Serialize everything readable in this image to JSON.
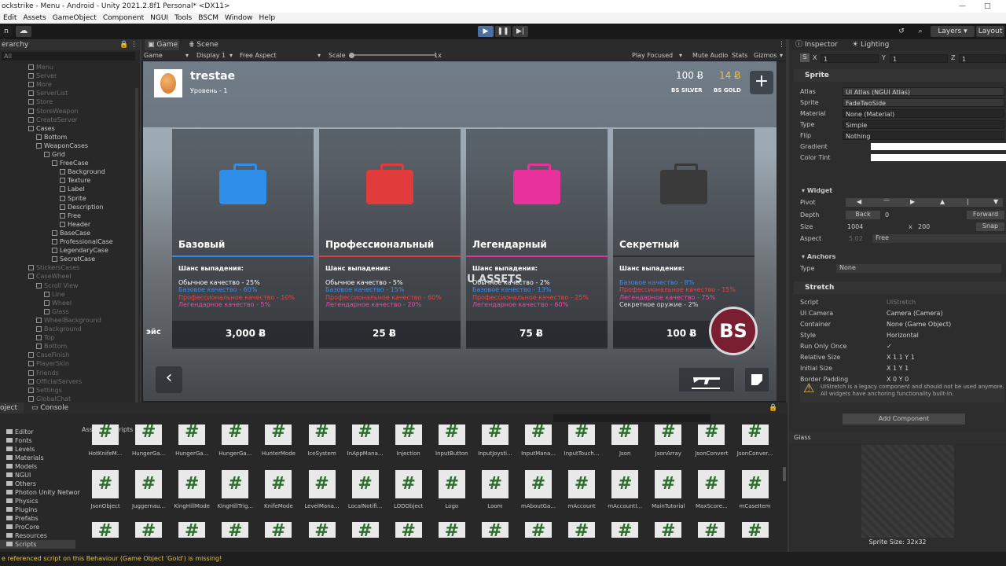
{
  "window": {
    "title": "ockstrike - Menu - Android - Unity 2021.2.8f1 Personal* <DX11>",
    "minimize": "—",
    "maximize": "□"
  },
  "menu": [
    "Edit",
    "Assets",
    "GameObject",
    "Component",
    "NGUI",
    "Tools",
    "BSCM",
    "Window",
    "Help"
  ],
  "toolbar": {
    "left_label": "n In",
    "layers": "Layers",
    "layout": "Layout"
  },
  "hierarchy": {
    "tab": "erarchy",
    "search_placeholder": "All",
    "items": [
      {
        "label": "Menu",
        "dim": true
      },
      {
        "label": "Server",
        "dim": true
      },
      {
        "label": "More",
        "dim": true
      },
      {
        "label": "ServerList",
        "dim": true
      },
      {
        "label": "Store",
        "dim": true
      },
      {
        "label": "StoreWeapon",
        "dim": true
      },
      {
        "label": "CreateServer",
        "dim": true
      },
      {
        "label": "Cases",
        "dim": false
      },
      {
        "label": "Bottom",
        "dim": false
      },
      {
        "label": "WeaponCases",
        "dim": false
      },
      {
        "label": "Grid",
        "dim": false
      },
      {
        "label": "FreeCase",
        "dim": false
      },
      {
        "label": "Background",
        "dim": false
      },
      {
        "label": "Texture",
        "dim": false
      },
      {
        "label": "Label",
        "dim": false
      },
      {
        "label": "Sprite",
        "dim": false
      },
      {
        "label": "Description",
        "dim": false
      },
      {
        "label": "Free",
        "dim": false
      },
      {
        "label": "Header",
        "dim": false
      },
      {
        "label": "BaseCase",
        "dim": false
      },
      {
        "label": "ProfessionalCase",
        "dim": false
      },
      {
        "label": "LegendaryCase",
        "dim": false
      },
      {
        "label": "SecretCase",
        "dim": false
      },
      {
        "label": "StickersCases",
        "dim": true
      },
      {
        "label": "CaseWheel",
        "dim": true
      },
      {
        "label": "Scroll View",
        "dim": true
      },
      {
        "label": "Line",
        "dim": true
      },
      {
        "label": "Wheel",
        "dim": true
      },
      {
        "label": "Glass",
        "dim": true
      },
      {
        "label": "WheelBackground",
        "dim": true
      },
      {
        "label": "Background",
        "dim": true
      },
      {
        "label": "Top",
        "dim": true
      },
      {
        "label": "Bottom",
        "dim": true
      },
      {
        "label": "CaseFinish",
        "dim": true
      },
      {
        "label": "PlayerSkin",
        "dim": true
      },
      {
        "label": "Friends",
        "dim": true
      },
      {
        "label": "OfficialServers",
        "dim": true
      },
      {
        "label": "Settings",
        "dim": true
      },
      {
        "label": "GlobalChat",
        "dim": true
      }
    ]
  },
  "game": {
    "tab_game": "Game",
    "tab_scene": "Scene",
    "display": "Game",
    "display_num": "Display 1",
    "aspect": "Free Aspect",
    "scale_label": "Scale",
    "scale_value": "1x",
    "play_focused": "Play Focused",
    "mute": "Mute Audio",
    "stats": "Stats",
    "gizmos": "Gizmos"
  },
  "hud": {
    "player": "trestae",
    "level": "Уровень - 1",
    "silver": "100 Ƀ",
    "silver_label": "BS SILVER",
    "gold": "14 Ƀ",
    "gold_label": "BS GOLD",
    "plus": "+",
    "bs_badge": "BS",
    "back": "‹",
    "watermark": "U ASSETS"
  },
  "cases": [
    {
      "title": "Базовый",
      "color": "#2f8ee8",
      "line": "#2f8ee8",
      "chance": "Шанс выпадения:",
      "lines": [
        {
          "t": "Обычное качество - 25%",
          "c": "#ffffff"
        },
        {
          "t": "Базовое качество - 60%",
          "c": "#3d8ef0"
        },
        {
          "t": "Профессиональное качество - 10%",
          "c": "#e84545"
        },
        {
          "t": "Легендарное качество - 5%",
          "c": "#e94ca8"
        }
      ],
      "price": "3,000 Ƀ"
    },
    {
      "title": "Профессиональный",
      "color": "#e13b3b",
      "line": "#e13b3b",
      "chance": "Шанс выпадения:",
      "lines": [
        {
          "t": "Обычное качество - 5%",
          "c": "#ffffff"
        },
        {
          "t": "Базовое качество - 15%",
          "c": "#3d8ef0"
        },
        {
          "t": "Профессиональное качество - 60%",
          "c": "#e84545"
        },
        {
          "t": "Легендарное качество - 20%",
          "c": "#e94ca8"
        }
      ],
      "price": "25 Ƀ"
    },
    {
      "title": "Легендарный",
      "color": "#e6329a",
      "line": "#e6329a",
      "chance": "Шанс выпадения:",
      "lines": [
        {
          "t": "Обычное качество - 2%",
          "c": "#ffffff"
        },
        {
          "t": "Базовое качество - 13%",
          "c": "#3d8ef0"
        },
        {
          "t": "Профессиональное качество - 25%",
          "c": "#e84545"
        },
        {
          "t": "Легендарное качество - 60%",
          "c": "#e94ca8"
        }
      ],
      "price": "75 Ƀ"
    },
    {
      "title": "Секретный",
      "color": "#3a3a3a",
      "line": "#2d2d2d",
      "chance": "Шанс выпадения:",
      "lines": [
        {
          "t": "Базовое качество - 8%",
          "c": "#3d8ef0"
        },
        {
          "t": "Профессиональное качество - 15%",
          "c": "#e84545"
        },
        {
          "t": "Легендарное качество - 75%",
          "c": "#e94ca8"
        },
        {
          "t": "Секретное оружие - 2%",
          "c": "#dddddd"
        }
      ],
      "price": "100 Ƀ"
    }
  ],
  "partial_price": "эйс",
  "bottom": {
    "tab_project": "oject",
    "tab_console": "Console",
    "breadcrumb": "Assets > Scripts",
    "folders": [
      "Editor",
      "Fonts",
      "Levels",
      "Materials",
      "Models",
      "NGUI",
      "Others",
      "Photon Unity Networ",
      "Physics",
      "Plugins",
      "Prefabs",
      "ProCore",
      "Resources",
      "Scripts"
    ],
    "row1": [
      "HotKnifeM...",
      "HungerGa...",
      "HungerGa...",
      "HungerGa...",
      "HunterMode",
      "IceSystem",
      "InAppMana...",
      "Injection",
      "InputButton",
      "InputJoysti...",
      "InputMana...",
      "InputTouch...",
      "Json",
      "JsonArray",
      "JsonConvert",
      "JsonConver..."
    ],
    "row2": [
      "JsonObject",
      "Juggernau...",
      "KingHillMode",
      "KingHillTrig...",
      "KnifeMode",
      "LevelMana...",
      "LocalNotifi...",
      "LODObject",
      "Logo",
      "Loom",
      "mAboutGa...",
      "mAccount",
      "mAccountI...",
      "MainTutorial",
      "MaxScore...",
      "mCaseItem"
    ],
    "glyph": "#"
  },
  "inspector": {
    "tab": "Inspector",
    "tab2": "Lighting",
    "sprite_header": "Sprite",
    "fields": [
      {
        "l": "Atlas",
        "v": "UI Atlas (NGUI Atlas)"
      },
      {
        "l": "Sprite",
        "v": "FadeTwoSide"
      },
      {
        "l": "Material",
        "v": "None (Material)"
      },
      {
        "l": "Type",
        "v": "Simple"
      },
      {
        "l": "Flip",
        "v": "Nothing"
      },
      {
        "l": "Gradient",
        "v": ""
      },
      {
        "l": "Color Tint",
        "v": ""
      }
    ],
    "widget": "Widget",
    "pivot": "Pivot",
    "depth": "Depth",
    "depth_back": "Back",
    "depth_val": "0",
    "depth_fwd": "Forward",
    "size": "Size",
    "size_x": "1004",
    "size_y": "200",
    "snap": "Snap",
    "aspect": "Aspect",
    "aspect_val": "5.02",
    "aspect_mode": "Free",
    "anchors": "Anchors",
    "anchors_type": "Type",
    "anchors_val": "None",
    "stretch": "Stretch",
    "stretch_fields": [
      {
        "l": "Script",
        "v": "UIStretch"
      },
      {
        "l": "UI Camera",
        "v": "Camera (Camera)"
      },
      {
        "l": "Container",
        "v": "None (Game Object)"
      },
      {
        "l": "Style",
        "v": "Horizontal"
      },
      {
        "l": "Run Only Once",
        "v": "✓"
      },
      {
        "l": "Relative Size",
        "v": "X 1.1   Y 1"
      },
      {
        "l": "Initial Size",
        "v": "X 1   Y 1"
      },
      {
        "l": "Border Padding",
        "v": "X 0   Y 0"
      }
    ],
    "warning": "UIStretch is a legacy component and should not be used anymore. All widgets have anchoring functionality built-in.",
    "add_component": "Add Component",
    "preview_title": "Glass",
    "sprite_size": "Sprite Size: 32x32"
  },
  "status": "e referenced script on this Behaviour (Game Object 'Gold') is missing!"
}
